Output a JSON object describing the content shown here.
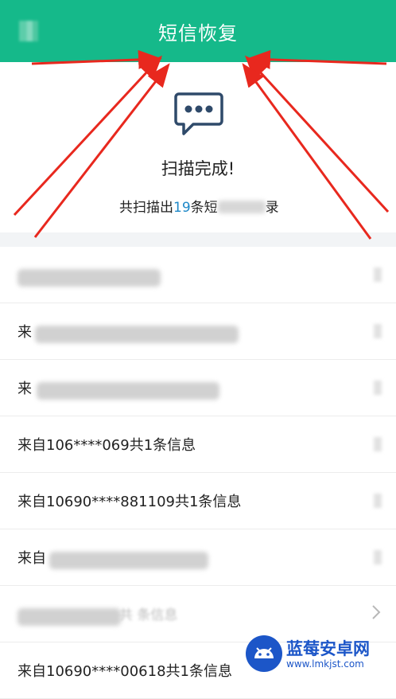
{
  "header": {
    "title": "短信恢复",
    "back_icon": "back-arrow-icon"
  },
  "status": {
    "icon": "message-bubble-icon",
    "done_text": "扫描完成!",
    "summary_prefix": "共扫描出",
    "summary_count": "19",
    "summary_suffix": "条短",
    "summary_end": "录"
  },
  "list": {
    "items": [
      {
        "label": ""
      },
      {
        "label": "来"
      },
      {
        "label": "来"
      },
      {
        "label": "来自106****069共1条信息"
      },
      {
        "label": "来自10690****881109共1条信息"
      },
      {
        "label": "来自"
      },
      {
        "label": ""
      },
      {
        "label": "来自10690****00618共1条信息"
      }
    ],
    "row7_partial": "共 条信息"
  },
  "watermark": {
    "brand": "蓝莓安卓网",
    "url": "www.lmkjst.com"
  },
  "colors": {
    "header": "#15b98a",
    "accent_number": "#1e88c8",
    "annotation_arrow": "#e8281e"
  }
}
